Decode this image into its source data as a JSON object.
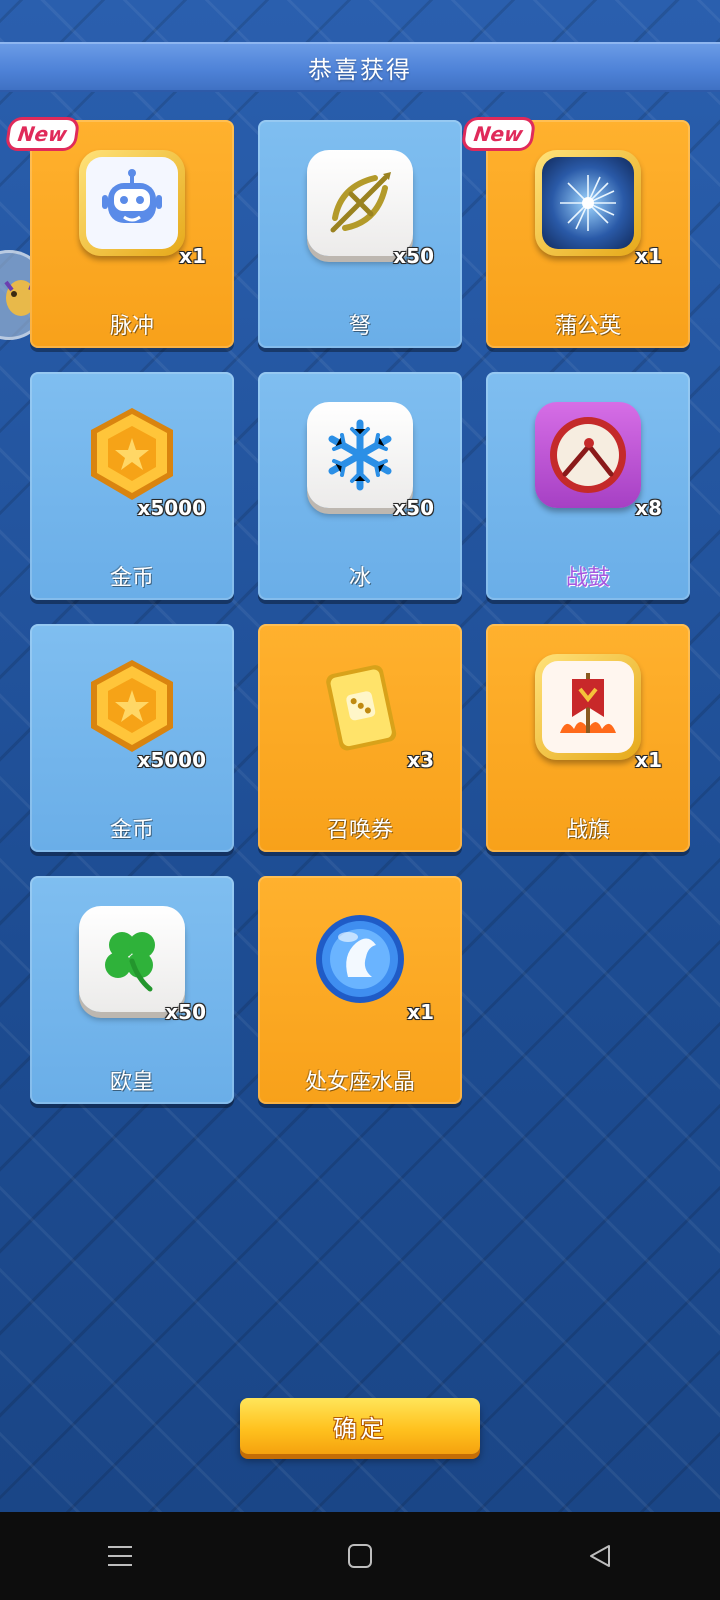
{
  "header": {
    "title": "恭喜获得"
  },
  "badge_text": "New",
  "rewards": [
    {
      "name": "脉冲",
      "qty": "x1",
      "style": "gold",
      "new": true,
      "icon": "robot-head-icon"
    },
    {
      "name": "弩",
      "qty": "x50",
      "style": "blue",
      "new": false,
      "icon": "crossbow-icon"
    },
    {
      "name": "蒲公英",
      "qty": "x1",
      "style": "gold",
      "new": true,
      "icon": "dandelion-icon"
    },
    {
      "name": "金币",
      "qty": "x5000",
      "style": "blue",
      "new": false,
      "icon": "gold-coin-icon"
    },
    {
      "name": "冰",
      "qty": "x50",
      "style": "blue",
      "new": false,
      "icon": "snowflake-icon"
    },
    {
      "name": "战鼓",
      "qty": "x8",
      "style": "blue",
      "new": false,
      "icon": "war-drum-icon",
      "name_color": "#a657e0"
    },
    {
      "name": "金币",
      "qty": "x5000",
      "style": "blue",
      "new": false,
      "icon": "gold-coin-icon"
    },
    {
      "name": "召唤券",
      "qty": "x3",
      "style": "gold",
      "new": false,
      "icon": "summon-ticket-icon"
    },
    {
      "name": "战旗",
      "qty": "x1",
      "style": "gold",
      "new": false,
      "icon": "war-banner-icon"
    },
    {
      "name": "欧皇",
      "qty": "x50",
      "style": "blue",
      "new": false,
      "icon": "four-leaf-clover-icon"
    },
    {
      "name": "处女座水晶",
      "qty": "x1",
      "style": "gold",
      "new": false,
      "icon": "virgo-crystal-icon"
    }
  ],
  "confirm_button": {
    "label": "确定"
  },
  "colors": {
    "gold_card": "#f8a11a",
    "blue_card": "#6aaee8",
    "background": "#1f4f96"
  },
  "system_nav": {
    "icons": [
      "menu-icon",
      "home-icon",
      "back-icon"
    ]
  }
}
